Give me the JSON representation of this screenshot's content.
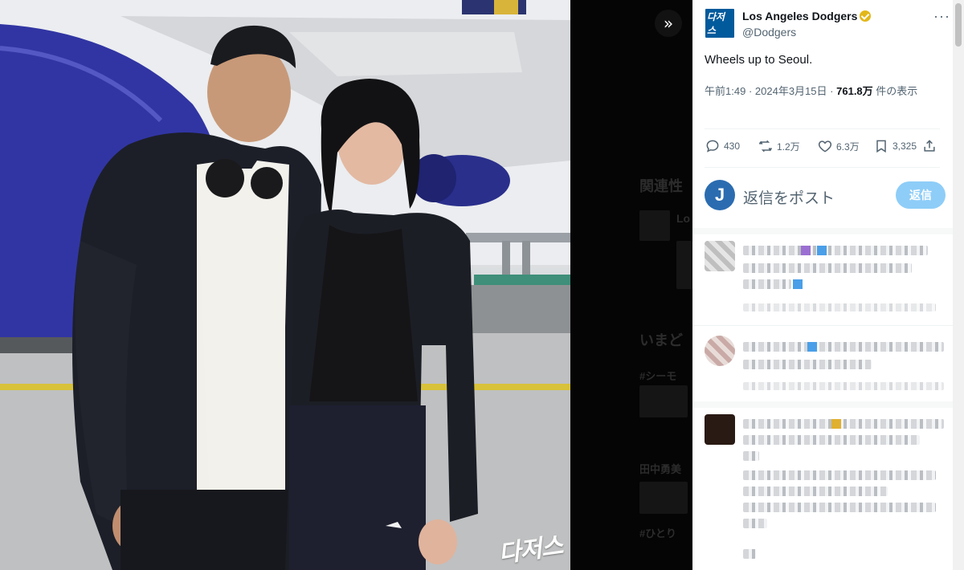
{
  "photo": {
    "watermark": "다저스"
  },
  "background_ghost": {
    "section1": "関連性",
    "item_prefix": "Lo",
    "section2": "いまど",
    "hashtag1": "#シーモ",
    "title3": "田中勇美",
    "hashtag2": "#ひとり"
  },
  "post": {
    "account_name": "Los Angeles Dodgers",
    "handle": "@Dodgers",
    "avatar_text": "다저스",
    "text": "Wheels up to Seoul.",
    "time": "午前1:49",
    "separator": "·",
    "date": "2024年3月15日",
    "views": "761.8万",
    "views_label": "件の表示",
    "stats": {
      "replies": "430",
      "reposts": "1.2万",
      "likes": "6.3万",
      "bookmarks": "3,325"
    }
  },
  "reply_compose": {
    "avatar_letter": "J",
    "placeholder": "返信をポスト",
    "button": "返信"
  },
  "colors": {
    "accent": "#1d9bf0",
    "reply_button": "#8ecdf8",
    "verified_badge": "#e2b719",
    "dodgers_blue": "#005a9c"
  },
  "icons": [
    "double-chevron-right-icon",
    "more-dots-icon",
    "verified-badge-icon",
    "reply-icon",
    "repost-icon",
    "like-icon",
    "bookmark-icon",
    "share-icon"
  ]
}
